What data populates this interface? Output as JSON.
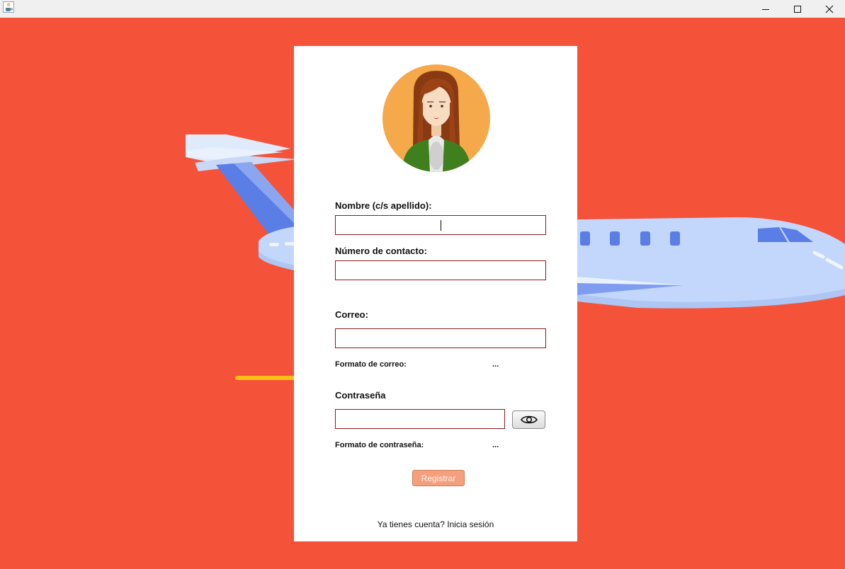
{
  "window": {
    "icon": "java-cup-icon",
    "controls": [
      "minimize-icon",
      "maximize-icon",
      "close-icon"
    ]
  },
  "background": {
    "color": "#f4533a",
    "illustration": "airplane"
  },
  "form": {
    "avatar": "woman-avatar",
    "name_label": "Nombre (c/s apellido):",
    "phone_label": "Número de contacto:",
    "email_label": "Correo:",
    "email_hint_label": "Formato de correo:",
    "email_hint_value": "...",
    "password_label": "Contraseña",
    "password_hint_label": "Formato de contraseña:",
    "password_hint_value": "...",
    "show_password_icon": "eye-icon",
    "register_label": "Registrar",
    "login_prompt": "Ya tienes cuenta? Inicia sesión",
    "field_border_color": "#8b1a1a",
    "button_color": "#f4a07e"
  }
}
